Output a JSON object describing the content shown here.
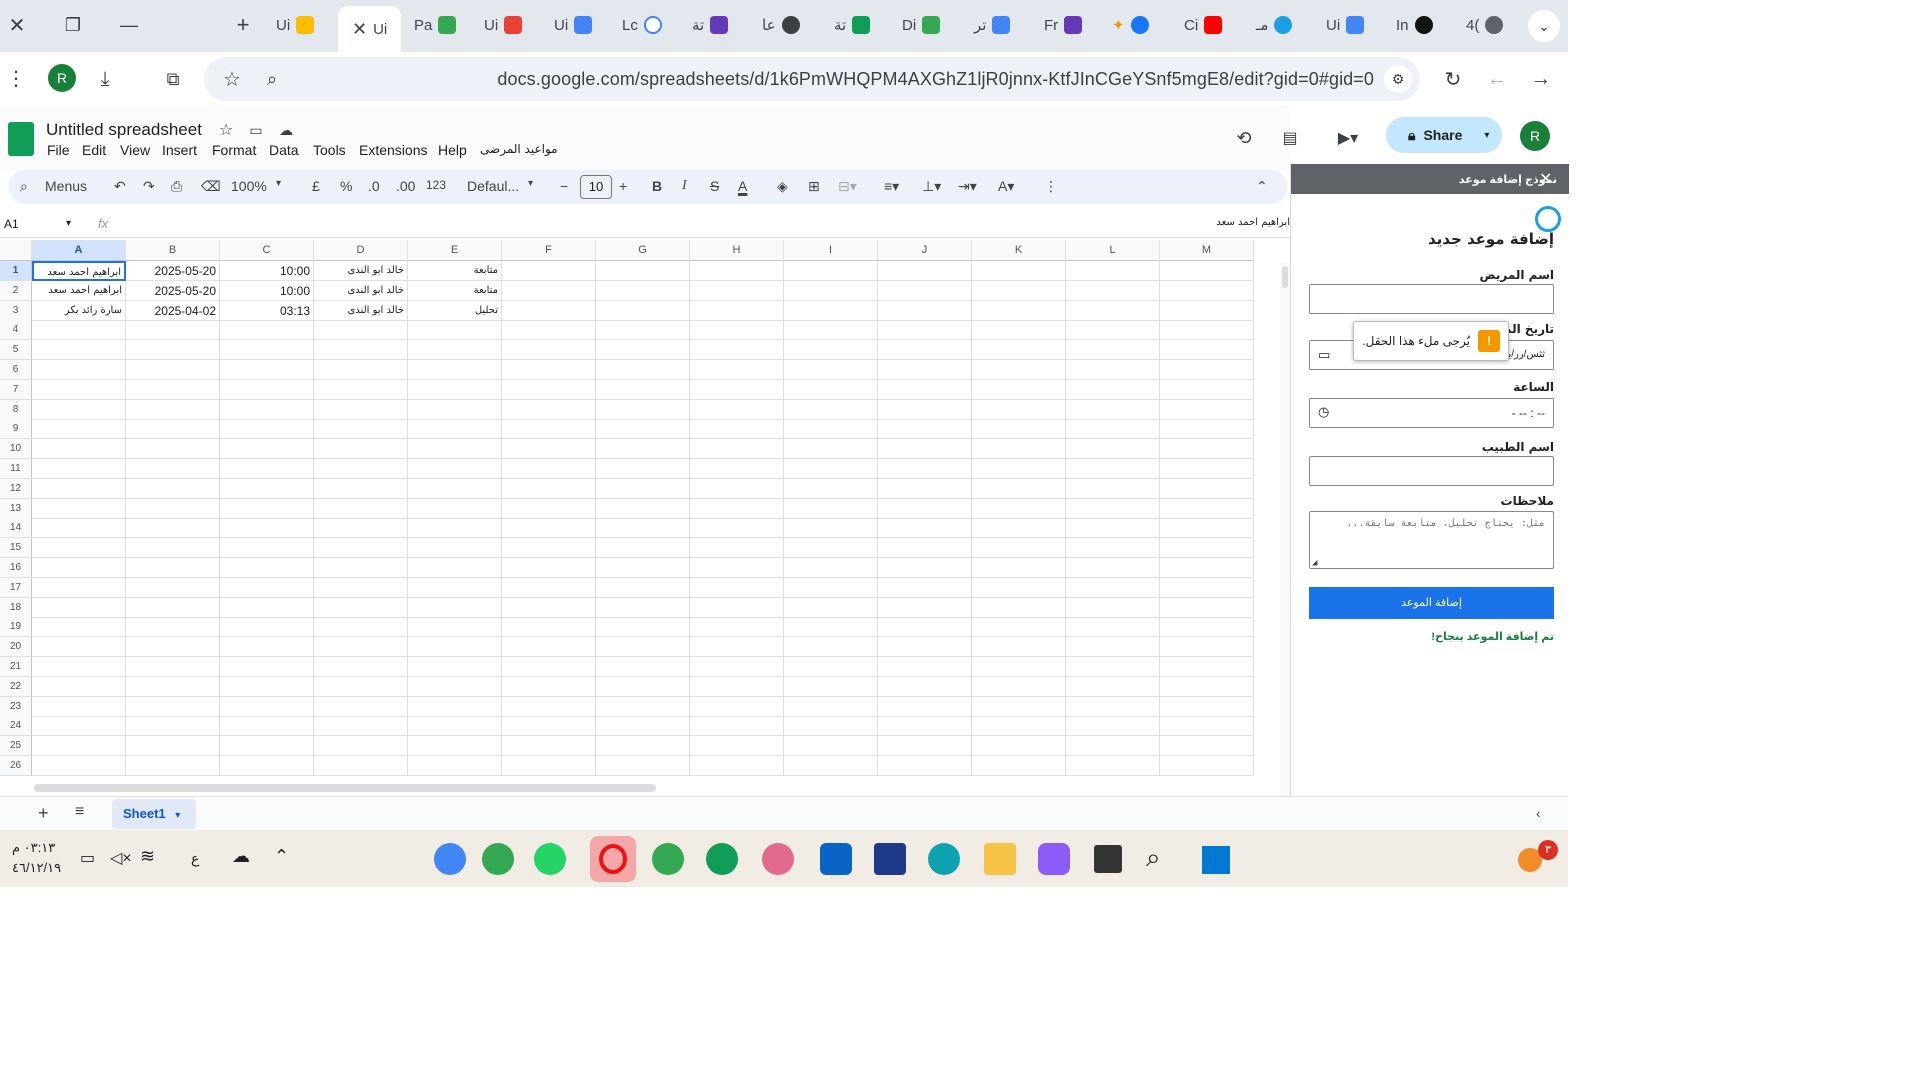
{
  "browser": {
    "url": "docs.google.com/spreadsheets/d/1k6PmWHQPM4AXGhZ1ljR0jnnx-KtfJInCGeYSnf5mgE8/edit?gid=0#gid=0",
    "profile_initial": "R",
    "tabs": [
      "Ui",
      "Ui",
      "Pa",
      "Ui",
      "Ui",
      "Lc",
      "تة",
      "عا",
      "تة",
      "Di",
      "تر",
      "Fr",
      "Ci",
      "مـ",
      "Ui",
      "In",
      "4("
    ]
  },
  "sheet": {
    "title": "Untitled spreadsheet",
    "menus": [
      "File",
      "Edit",
      "View",
      "Insert",
      "Format",
      "Data",
      "Tools",
      "Extensions",
      "Help",
      "مواعيد المرضى"
    ],
    "share_label": "Share",
    "toolbar": {
      "search": "Menus",
      "zoom": "100%",
      "currency": "£",
      "percent": "%",
      "dec_dec": ".0",
      "inc_dec": ".00",
      "numfmt": "123",
      "font": "Defaul...",
      "size": "10"
    },
    "name_box": "A1",
    "formula_value": "ابراهيم احمد سعد",
    "columns": [
      "A",
      "B",
      "C",
      "D",
      "E",
      "F",
      "G",
      "H",
      "I",
      "J",
      "K",
      "L",
      "M"
    ],
    "row_numbers": [
      "1",
      "2",
      "3",
      "4",
      "5",
      "6",
      "7",
      "8",
      "9",
      "10",
      "11",
      "12",
      "13",
      "14",
      "15",
      "16",
      "17",
      "18",
      "19",
      "20",
      "21",
      "22",
      "23",
      "24",
      "25",
      "26"
    ],
    "rows": [
      [
        "ابراهيم احمد سعد",
        "2025-05-20",
        "10:00",
        "خالد ابو الندى",
        "متابعة"
      ],
      [
        "ابراهيم احمد سعد",
        "2025-05-20",
        "10:00",
        "خالد ابو الندى",
        "متابعة"
      ],
      [
        "سارة رائد بكر",
        "2025-04-02",
        "03:13",
        "خالد ابو الندى",
        "تحليل"
      ]
    ],
    "sheet_tab": "Sheet1"
  },
  "panel": {
    "header": "نموذج إضافة موعد",
    "heading": "إضافة موعد جديد",
    "patient_label": "اسم المريض",
    "date_label": "تاريخ الموعد",
    "date_placeholder": "ثثس/رر/يييي",
    "time_label": "الساعة",
    "time_placeholder": "-- : -- -",
    "doctor_label": "اسم الطبيب",
    "notes_label": "ملاحظات",
    "notes_placeholder": "مثل: يحتاج تحليل، متابعة سابقة...",
    "submit_label": "إضافة الموعد",
    "success_msg": "تم إضافة الموعد بنجاح!",
    "tooltip_msg": "يُرجى ملء هذا الحقل."
  },
  "taskbar": {
    "time": "٠٣:١٣ م",
    "date": "٤٦/١٢/١٩",
    "lang": "ع",
    "badge": "٣"
  }
}
